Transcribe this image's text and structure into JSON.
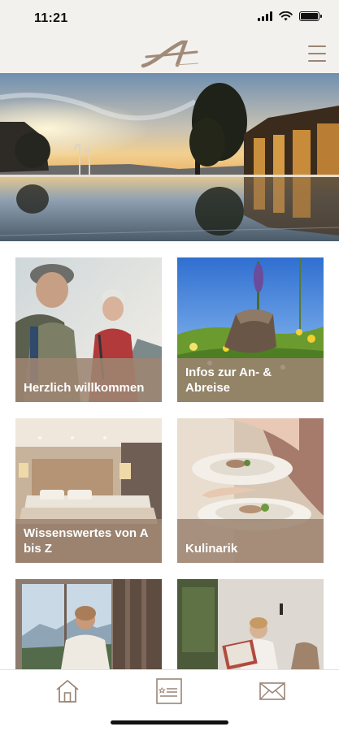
{
  "status_bar": {
    "time": "11:21"
  },
  "header": {
    "logo": "A",
    "menu_icon": "hamburger-menu-icon"
  },
  "hero": {
    "image": "infinity-pool-sunset-photo"
  },
  "tiles": [
    {
      "label": "Herzlich willkommen",
      "image": "cyclists-photo"
    },
    {
      "label": "Infos zur An- & Abreise",
      "image": "alpine-meadow-backpack-photo"
    },
    {
      "label": "Wissenswertes von A bis Z",
      "image": "hotel-room-photo"
    },
    {
      "label": "Kulinarik",
      "image": "food-plates-photo"
    },
    {
      "label": "",
      "image": "woman-window-mountains-photo"
    },
    {
      "label": "",
      "image": "woman-reading-magazine-photo"
    }
  ],
  "tab_bar": {
    "items": [
      {
        "icon": "home-icon"
      },
      {
        "icon": "card-list-icon"
      },
      {
        "icon": "envelope-icon"
      }
    ]
  },
  "colors": {
    "accent": "#9d8572",
    "header_bg": "#f3f1ee"
  }
}
